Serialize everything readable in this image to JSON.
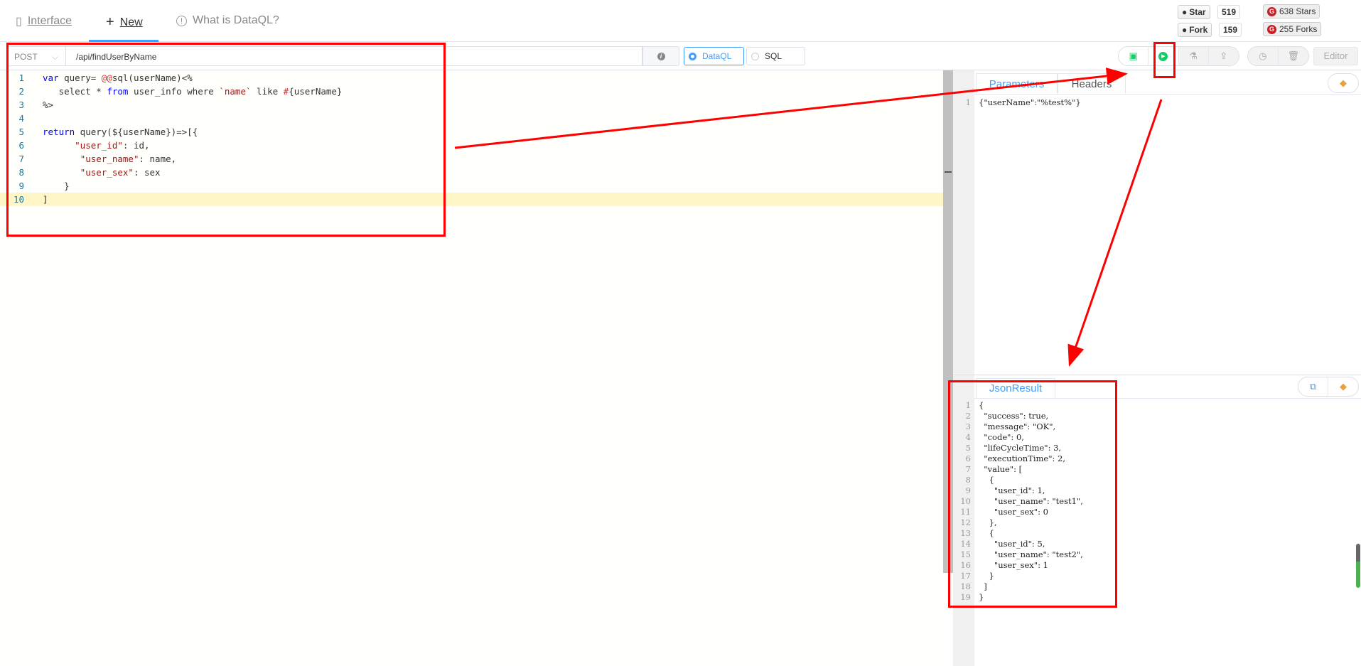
{
  "nav": {
    "tabs": [
      {
        "label": "Interface",
        "icon": "book-icon"
      },
      {
        "label": "New",
        "icon": "plus-icon"
      },
      {
        "label": "What is DataQL?",
        "icon": "info-circle-icon"
      }
    ],
    "active": "New"
  },
  "badges": {
    "star_label": "Star",
    "star_count": "519",
    "fork_label": "Fork",
    "fork_count": "159",
    "gitee_stars": "638 Stars",
    "gitee_forks": "255 Forks"
  },
  "toolbar": {
    "method": "POST",
    "path": "/api/findUserByName",
    "modes": [
      "DataQL",
      "SQL"
    ],
    "selected_mode": "DataQL",
    "editor_label": "Editor"
  },
  "editor": {
    "lines": [
      [
        {
          "t": "var",
          "c": "kw"
        },
        {
          "t": " query= "
        },
        {
          "t": "@@",
          "c": "at"
        },
        {
          "t": "sql(userName)<%"
        }
      ],
      [
        {
          "t": "   select * "
        },
        {
          "t": "from",
          "c": "kw"
        },
        {
          "t": " user_info where "
        },
        {
          "t": "`name`",
          "c": "str"
        },
        {
          "t": " like "
        },
        {
          "t": "#",
          "c": "at"
        },
        {
          "t": "{userName}"
        }
      ],
      [
        {
          "t": "%>"
        }
      ],
      [],
      [
        {
          "t": "return",
          "c": "kw"
        },
        {
          "t": " query(${userName})=>[{"
        }
      ],
      [
        {
          "t": "      "
        },
        {
          "t": "\"user_id\"",
          "c": "str"
        },
        {
          "t": ": id,"
        }
      ],
      [
        {
          "t": "       "
        },
        {
          "t": "\"user_name\"",
          "c": "str"
        },
        {
          "t": ": name,"
        }
      ],
      [
        {
          "t": "       "
        },
        {
          "t": "\"user_sex\"",
          "c": "str"
        },
        {
          "t": ": sex"
        }
      ],
      [
        {
          "t": "    }"
        }
      ],
      [
        {
          "t": "]"
        }
      ]
    ],
    "highlighted_line": 10
  },
  "params": {
    "tabs": [
      "Parameters",
      "Headers"
    ],
    "active": "Parameters",
    "lines": [
      "{\"userName\":\"%test%\"}"
    ]
  },
  "result": {
    "tab": "JsonResult",
    "lines": [
      "{",
      "  \"success\": true,",
      "  \"message\": \"OK\",",
      "  \"code\": 0,",
      "  \"lifeCycleTime\": 3,",
      "  \"executionTime\": 2,",
      "  \"value\": [",
      "    {",
      "      \"user_id\": 1,",
      "      \"user_name\": \"test1\",",
      "      \"user_sex\": 0",
      "    },",
      "    {",
      "      \"user_id\": 5,",
      "      \"user_name\": \"test2\",",
      "      \"user_sex\": 1",
      "    }",
      "  ]",
      "}"
    ]
  },
  "colors": {
    "accent": "#409eff",
    "run": "#13ce66",
    "annotation": "#ff0000"
  }
}
